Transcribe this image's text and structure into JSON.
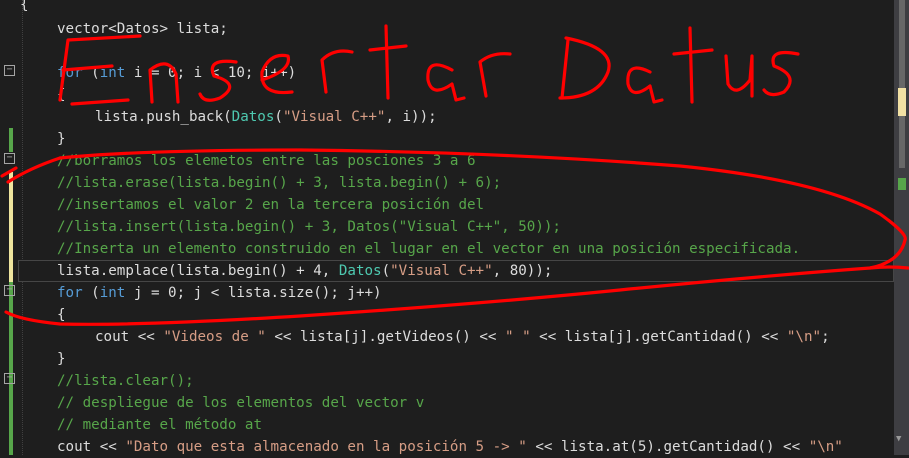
{
  "editor": {
    "lines": {
      "l0": "{",
      "l1": "vector<Datos> lista;",
      "l2_for": "for",
      "l2_paren": " (",
      "l2_int": "int",
      "l2_rest": " i = 0; i < 10; i++)",
      "l3": "{",
      "l4_a": "lista.push_back(",
      "l4_type": "Datos",
      "l4_b": "(",
      "l4_str": "\"Visual C++\"",
      "l4_c": ", i));",
      "l5": "}",
      "c1": "//borramos los elemetos entre las posciones 3 a 6",
      "c2": "//lista.erase(lista.begin() + 3, lista.begin() + 6);",
      "c3": "//insertamos el valor 2 en la tercera posición del",
      "c4": "//lista.insert(lista.begin() + 3, Datos(\"Visual C++\", 50));",
      "c5": "//Inserta un elemento construido en el lugar en el vector en una posición especificada.",
      "l11_a": "lista.emplace(lista.begin() + 4, ",
      "l11_type": "Datos",
      "l11_b": "(",
      "l11_str": "\"Visual C++\"",
      "l11_c": ", 80));",
      "l12_for": "for",
      "l12_paren": " (",
      "l12_int": "int",
      "l12_rest": " j = 0; j < lista.size(); j++)",
      "l13": "{",
      "l14_a": "cout << ",
      "l14_s1": "\"Videos de \"",
      "l14_b": " << lista[j].getVideos() << ",
      "l14_s2": "\" \"",
      "l14_c": " << lista[j].getCantidad() << ",
      "l14_s3": "\"\\n\"",
      "l14_d": ";",
      "l15": "}",
      "c6": "//lista.clear();",
      "c7": "// despliegue de los elementos del vector v",
      "c8": "// mediante el método at",
      "l19_a": "cout << ",
      "l19_s1": "\"Dato que esta almacenado en la posición 5 -> \"",
      "l19_b": " << lista.at(5).getCantidad() << ",
      "l19_s2": "\"\\n\""
    },
    "fold_glyph": "−"
  },
  "colors": {
    "background": "#1e1e1e",
    "keyword": "#569cd6",
    "type": "#4ec9b0",
    "string": "#d69d85",
    "comment": "#57a64a",
    "ink": "#ff0000",
    "change_saved": "#57a64a",
    "change_unsaved": "#efe59e"
  }
}
